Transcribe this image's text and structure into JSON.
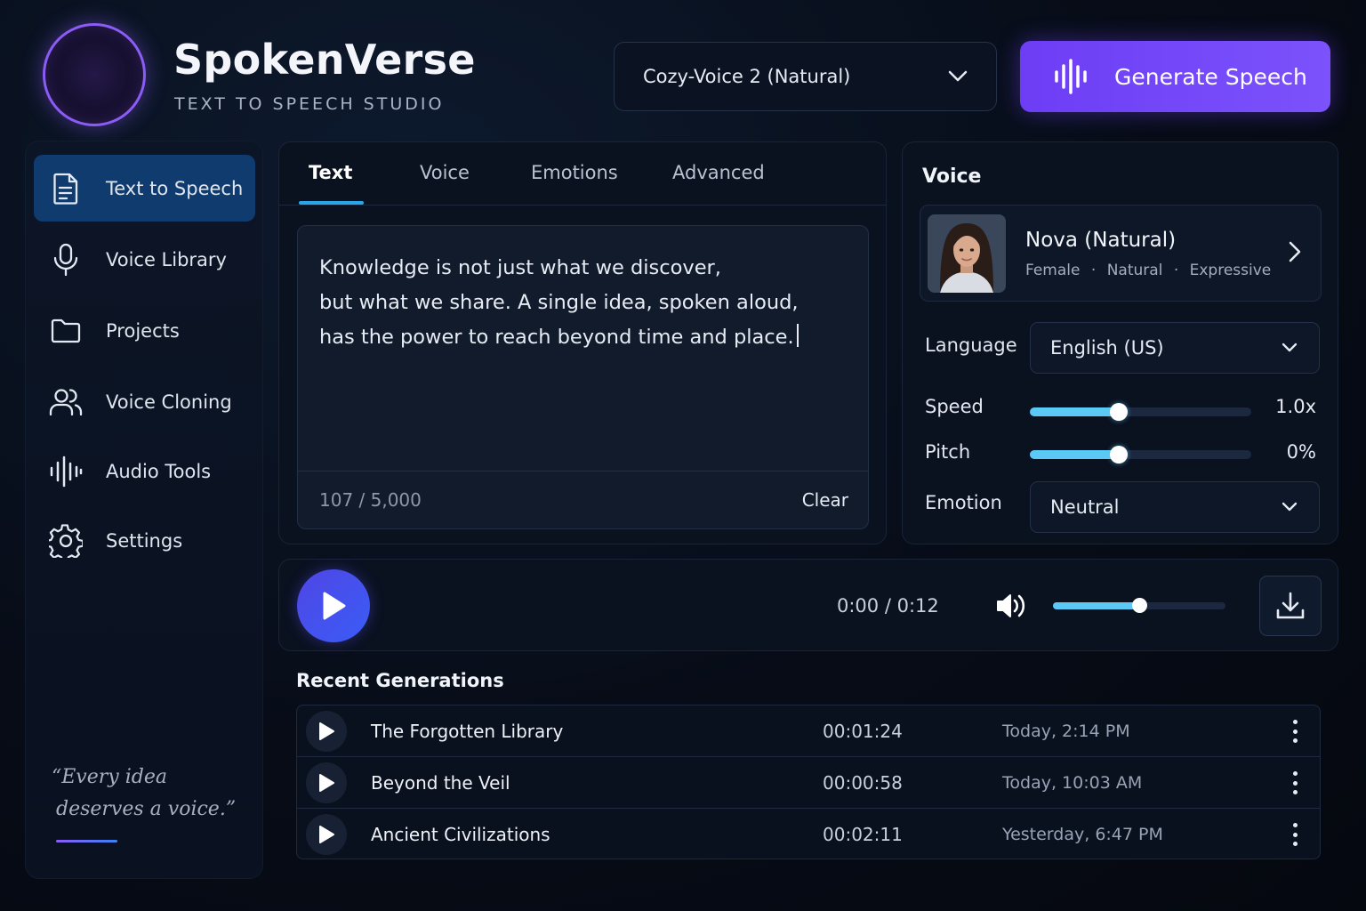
{
  "brand": {
    "title": "SpokenVerse",
    "subtitle": "TEXT TO SPEECH STUDIO",
    "logo_icon": "waveform-icon"
  },
  "header": {
    "model_select": "Cozy-Voice 2 (Natural)",
    "generate_label": "Generate Speech"
  },
  "sidebar": {
    "items": [
      {
        "label": "Text to Speech",
        "icon": "document-icon",
        "active": true
      },
      {
        "label": "Voice Library",
        "icon": "microphone-icon"
      },
      {
        "label": "Projects",
        "icon": "folder-icon"
      },
      {
        "label": "Voice Cloning",
        "icon": "users-icon"
      },
      {
        "label": "Audio Tools",
        "icon": "waveform-icon"
      },
      {
        "label": "Settings",
        "icon": "gear-icon"
      }
    ],
    "quote_line1": "“Every idea",
    "quote_line2": "deserves a voice.”"
  },
  "editor": {
    "tabs": [
      "Text",
      "Voice",
      "Emotions",
      "Advanced"
    ],
    "active_tab": "Text",
    "lines": [
      "Knowledge is not just what we discover,",
      "but what we share. A single idea, spoken aloud,",
      "has the power to reach beyond time and place."
    ],
    "char_count": "107 / 5,000",
    "clear_label": "Clear"
  },
  "voice_panel": {
    "title": "Voice",
    "voice_name": "Nova (Natural)",
    "tags": [
      "Female",
      "Natural",
      "Expressive"
    ],
    "language_label": "Language",
    "language_value": "English (US)",
    "speed_label": "Speed",
    "speed_value": "1.0x",
    "speed_fraction": 0.4,
    "pitch_label": "Pitch",
    "pitch_value": "0%",
    "pitch_fraction": 0.4,
    "emotion_label": "Emotion",
    "emotion_value": "Neutral"
  },
  "player": {
    "time": "0:00 / 0:12",
    "volume_fraction": 0.5
  },
  "recent": {
    "title": "Recent Generations",
    "rows": [
      {
        "title": "The Forgotten Library",
        "duration": "00:01:24",
        "date": "Today, 2:14 PM"
      },
      {
        "title": "Beyond the Veil",
        "duration": "00:00:58",
        "date": "Today, 10:03 AM"
      },
      {
        "title": "Ancient Civilizations",
        "duration": "00:02:11",
        "date": "Yesterday, 6:47 PM"
      }
    ]
  },
  "colors": {
    "accent_purple": "#7b52fb",
    "accent_blue": "#2aa6e8",
    "slider": "#5cc8f5",
    "active_nav": "#0f3b6e"
  }
}
